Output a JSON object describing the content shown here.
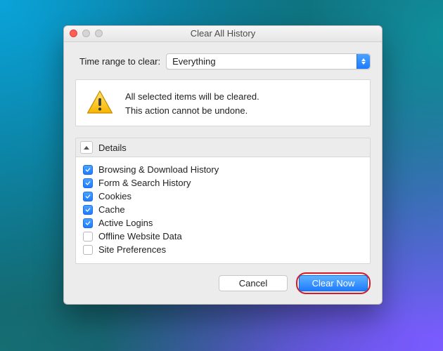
{
  "window": {
    "title": "Clear All History"
  },
  "range": {
    "label": "Time range to clear:",
    "selected": "Everything"
  },
  "warning": {
    "line1": "All selected items will be cleared.",
    "line2": "This action cannot be undone."
  },
  "details": {
    "header": "Details",
    "items": [
      {
        "label": "Browsing & Download History",
        "checked": true
      },
      {
        "label": "Form & Search History",
        "checked": true
      },
      {
        "label": "Cookies",
        "checked": true
      },
      {
        "label": "Cache",
        "checked": true
      },
      {
        "label": "Active Logins",
        "checked": true
      },
      {
        "label": "Offline Website Data",
        "checked": false
      },
      {
        "label": "Site Preferences",
        "checked": false
      }
    ]
  },
  "buttons": {
    "cancel": "Cancel",
    "clear_now": "Clear Now"
  }
}
